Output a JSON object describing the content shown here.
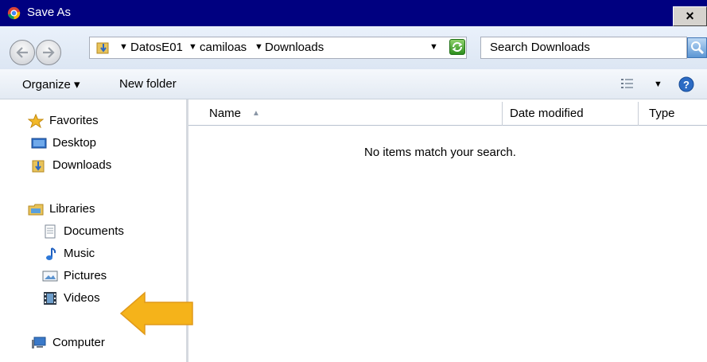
{
  "window": {
    "title": "Save As",
    "close_label": "×"
  },
  "address": {
    "crumbs": [
      "DatosE01",
      "camiloas",
      "Downloads"
    ]
  },
  "search": {
    "placeholder": "Search Downloads"
  },
  "toolbar": {
    "organize_label": "Organize ▾",
    "new_folder_label": "New folder"
  },
  "nav": {
    "favorites": "Favorites",
    "desktop": "Desktop",
    "downloads": "Downloads",
    "libraries": "Libraries",
    "documents": "Documents",
    "music": "Music",
    "pictures": "Pictures",
    "videos": "Videos",
    "computer": "Computer"
  },
  "columns": {
    "name": "Name",
    "date_modified": "Date modified",
    "type": "Type"
  },
  "content": {
    "empty_message": "No items match your search."
  },
  "colors": {
    "titlebar": "#000080",
    "annotation_arrow": "#f5b31a"
  }
}
